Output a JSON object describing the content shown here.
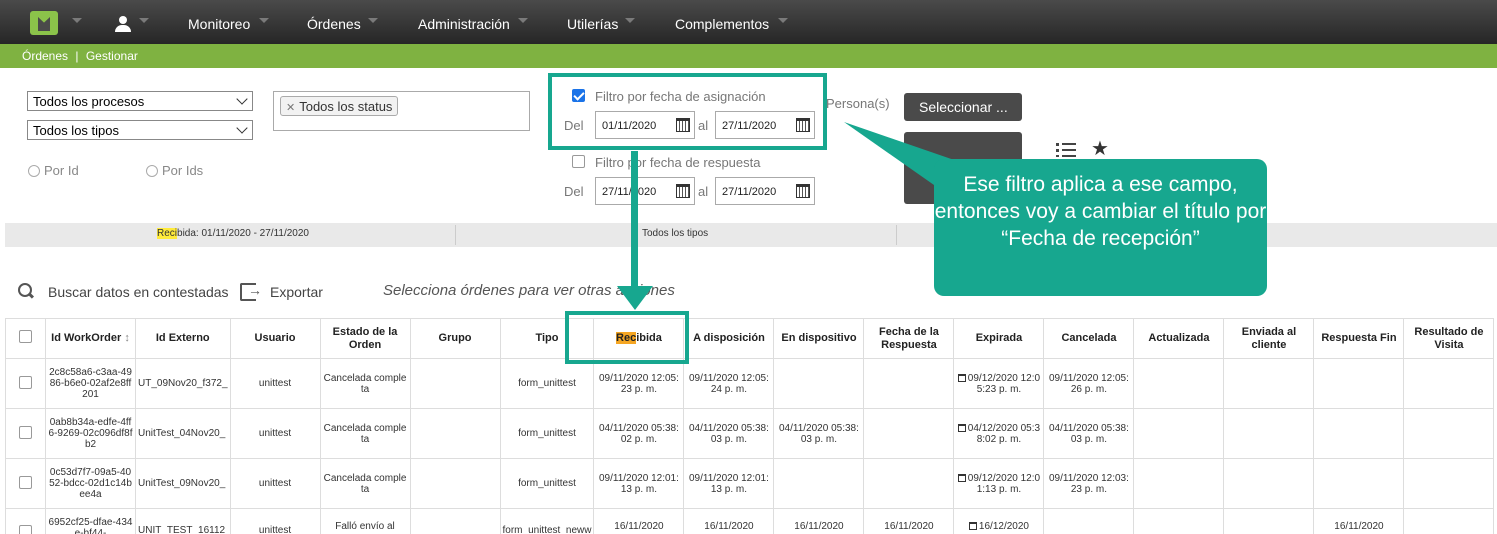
{
  "nav": {
    "items": [
      "Monitoreo",
      "Órdenes",
      "Administración",
      "Utilerías",
      "Complementos"
    ]
  },
  "breadcrumb": {
    "section": "Órdenes",
    "separator": "|",
    "page": "Gestionar"
  },
  "filters": {
    "process_select": "Todos los procesos",
    "type_select": "Todos los tipos",
    "status_tag": "Todos los status",
    "radio_by_id": "Por Id",
    "radio_by_ids": "Por Ids",
    "assign_filter_label": "Filtro por fecha de asignación",
    "assign_from_label": "Del",
    "assign_from": "01/11/2020",
    "assign_to_label": "al",
    "assign_to": "27/11/2020",
    "response_filter_label": "Filtro por fecha de respuesta",
    "response_from_label": "Del",
    "response_from": "27/11/2020",
    "response_to_label": "al",
    "response_to": "27/11/2020",
    "persons_label": "Persona(s)",
    "select_button": "Seleccionar ..."
  },
  "summary": {
    "received_hl": "Reci",
    "received_rest": "bida: 01/11/2020 - 27/11/2020",
    "types": "Todos los tipos"
  },
  "toolbar": {
    "search_label": "Buscar datos en contestadas",
    "export_label": "Exportar",
    "hint": "Selecciona órdenes para ver otras acciones"
  },
  "table": {
    "headers": [
      "Id WorkOrder",
      "Id Externo",
      "Usuario",
      "Estado de la Orden",
      "Grupo",
      "Tipo",
      "Recibida",
      "A disposición",
      "En dispositivo",
      "Fecha de la Respuesta",
      "Expirada",
      "Cancelada",
      "Actualizada",
      "Enviada al cliente",
      "Respuesta Fin",
      "Resultado de Visita"
    ],
    "received_hl": "Rec",
    "received_rest": "ibida",
    "rows": [
      [
        "2c8c58a6-c3aa-4986-b6e0-02af2e8ff201",
        "UT_09Nov20_f372_",
        "unittest",
        "Cancelada completa",
        "",
        "form_unittest",
        "09/11/2020 12:05:23 p. m.",
        "09/11/2020 12:05:24 p. m.",
        "",
        "",
        "09/12/2020 12:05:23 p. m.",
        "09/11/2020 12:05:26 p. m.",
        "",
        "",
        "",
        ""
      ],
      [
        "0ab8b34a-edfe-4ff6-9269-02c096df8fb2",
        "UnitTest_04Nov20_",
        "unittest",
        "Cancelada completa",
        "",
        "form_unittest",
        "04/11/2020 05:38:02 p. m.",
        "04/11/2020 05:38:03 p. m.",
        "04/11/2020 05:38:03 p. m.",
        "",
        "04/12/2020 05:38:02 p. m.",
        "04/11/2020 05:38:03 p. m.",
        "",
        "",
        "",
        ""
      ],
      [
        "0c53d7f7-09a5-4052-bdcc-02d1c14bee4a",
        "UnitTest_09Nov20_",
        "unittest",
        "Cancelada completa",
        "",
        "form_unittest",
        "09/11/2020 12:01:13 p. m.",
        "09/11/2020 12:01:13 p. m.",
        "",
        "",
        "09/12/2020 12:01:13 p. m.",
        "09/11/2020 12:03:23 p. m.",
        "",
        "",
        "",
        ""
      ],
      [
        "6952cf25-dfae-434e-bf44-",
        "UNIT_TEST_16112",
        "unittest",
        "Falló envío al",
        "",
        "form_unittest_neww",
        "16/11/2020",
        "16/11/2020",
        "16/11/2020",
        "16/11/2020",
        "16/12/2020",
        "",
        "",
        "",
        "16/11/2020",
        ""
      ]
    ]
  },
  "annotation": {
    "callout_text": "Ese filtro aplica a ese campo, entonces voy a cambiar el título por “Fecha de recepción”",
    "color": "#17a78f"
  }
}
